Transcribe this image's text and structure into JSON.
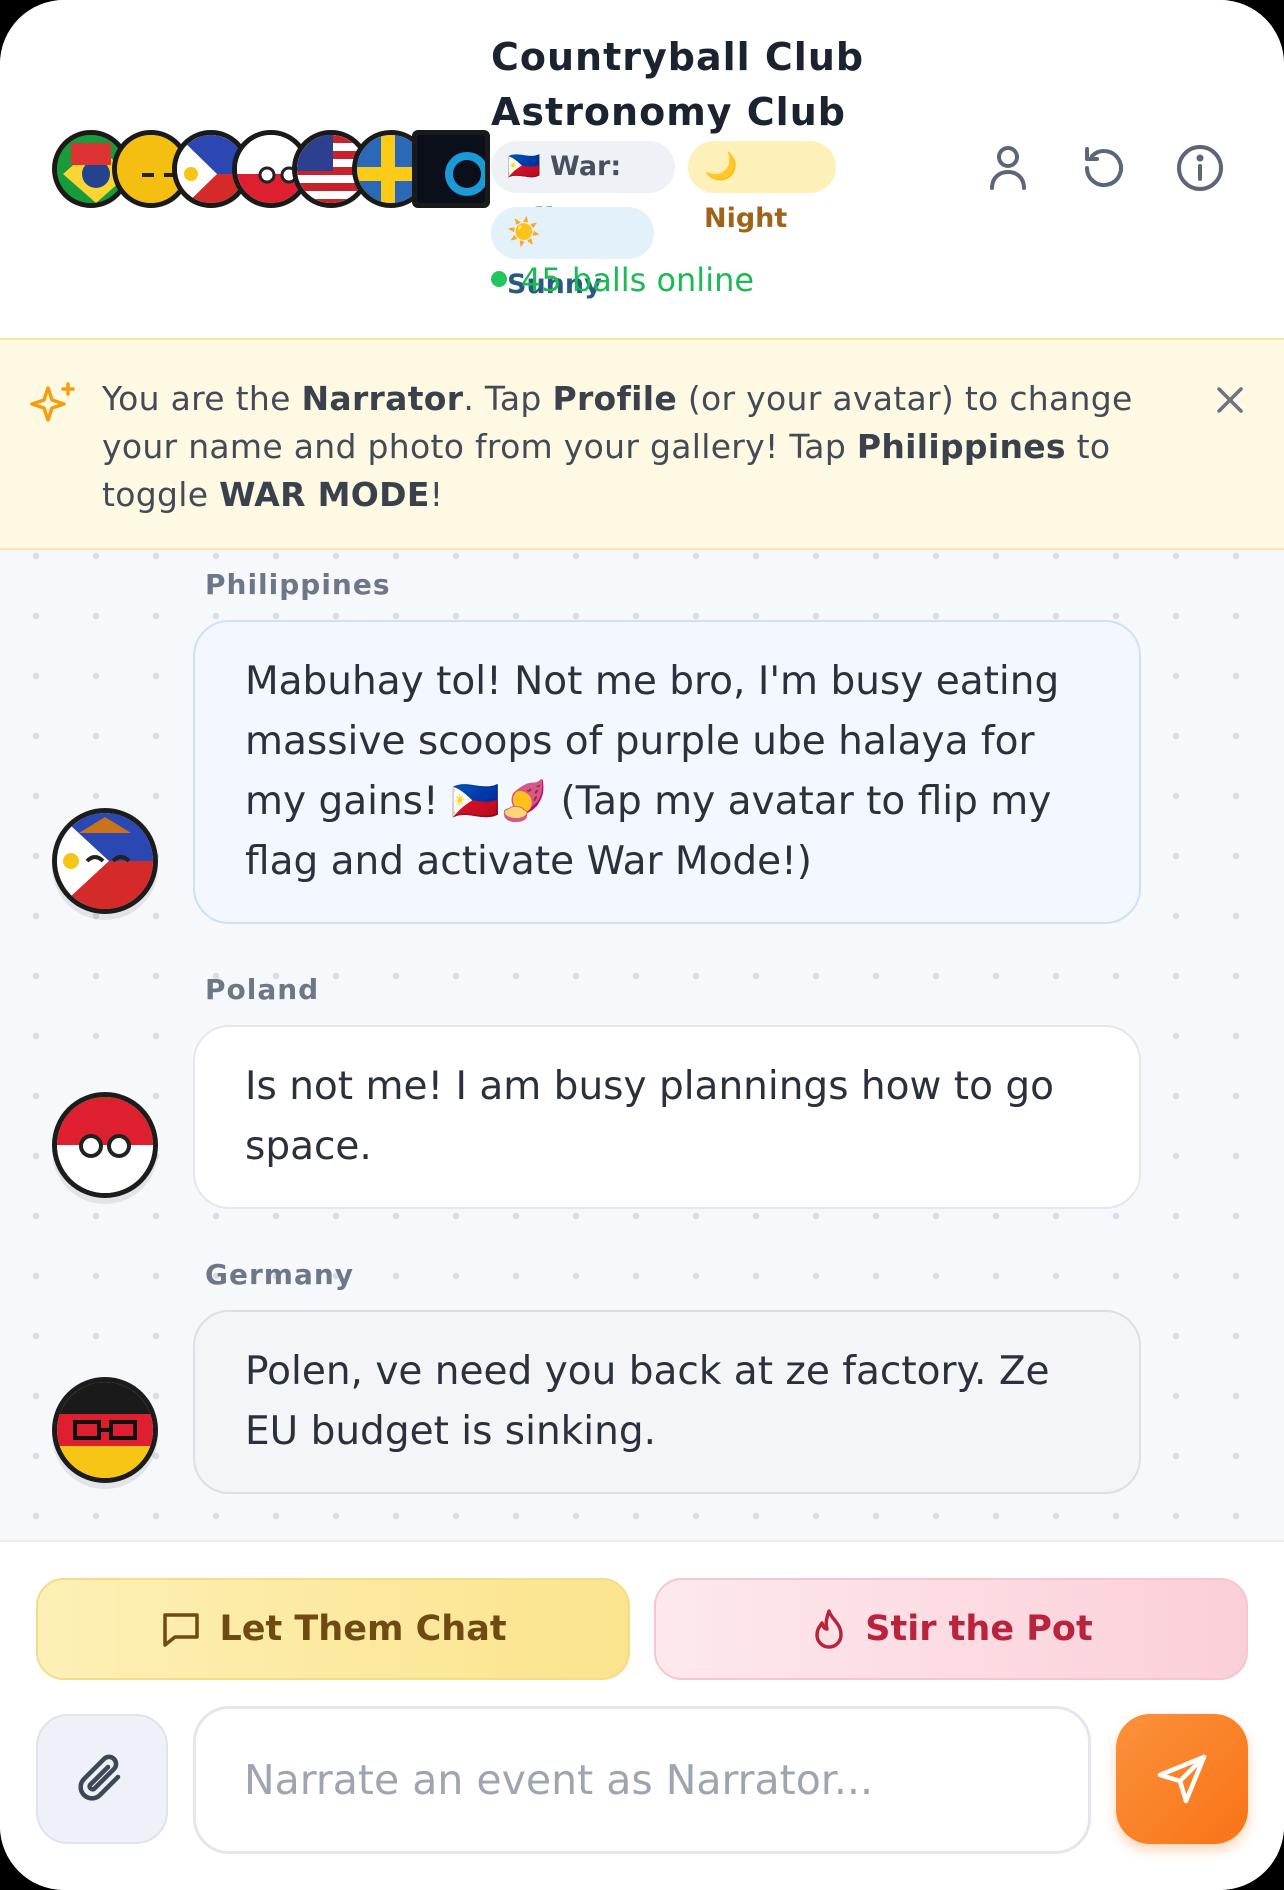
{
  "header": {
    "title_line1": "Countryball Club",
    "title_line2": "Astronomy Club",
    "chips": {
      "war": "🇵🇭 War: Off",
      "night": "🌙 Night",
      "weather": "☀️ Sunny"
    },
    "online": "45 balls online",
    "member_avatars": [
      "brazil-ball",
      "vietnam-ball",
      "philippines-ball",
      "poland-ball",
      "usa-ball",
      "sweden-ball",
      "estonia-ball"
    ]
  },
  "banner": {
    "pre": "You are the ",
    "narrator": "Narrator",
    "mid1": ". Tap ",
    "profile": "Profile",
    "mid2": " (or your avatar) to change your name and photo from your gallery! Tap ",
    "philippines": "Philippines",
    "mid3": " to toggle ",
    "war_mode": "WAR MODE",
    "end": "!"
  },
  "messages": [
    {
      "sender": "Philippines",
      "text": "Mabuhay tol! Not me bro, I'm busy eating massive scoops of purple ube halaya for my gains! 🇵🇭🍠 (Tap my avatar to flip my flag and activate War Mode!)"
    },
    {
      "sender": "Poland",
      "text": "Is not me! I am busy plannings how to go space."
    },
    {
      "sender": "Germany",
      "text": "Polen, ve need you back at ze factory. Ze EU budget is sinking."
    }
  ],
  "actions": {
    "let_them_chat": "Let Them Chat",
    "stir_the_pot": "Stir the Pot"
  },
  "composer": {
    "placeholder": "Narrate an event as Narrator..."
  },
  "colors": {
    "accent_orange": "#f97316",
    "online_green": "#22c55e",
    "banner_bg": "#fef9e3"
  }
}
